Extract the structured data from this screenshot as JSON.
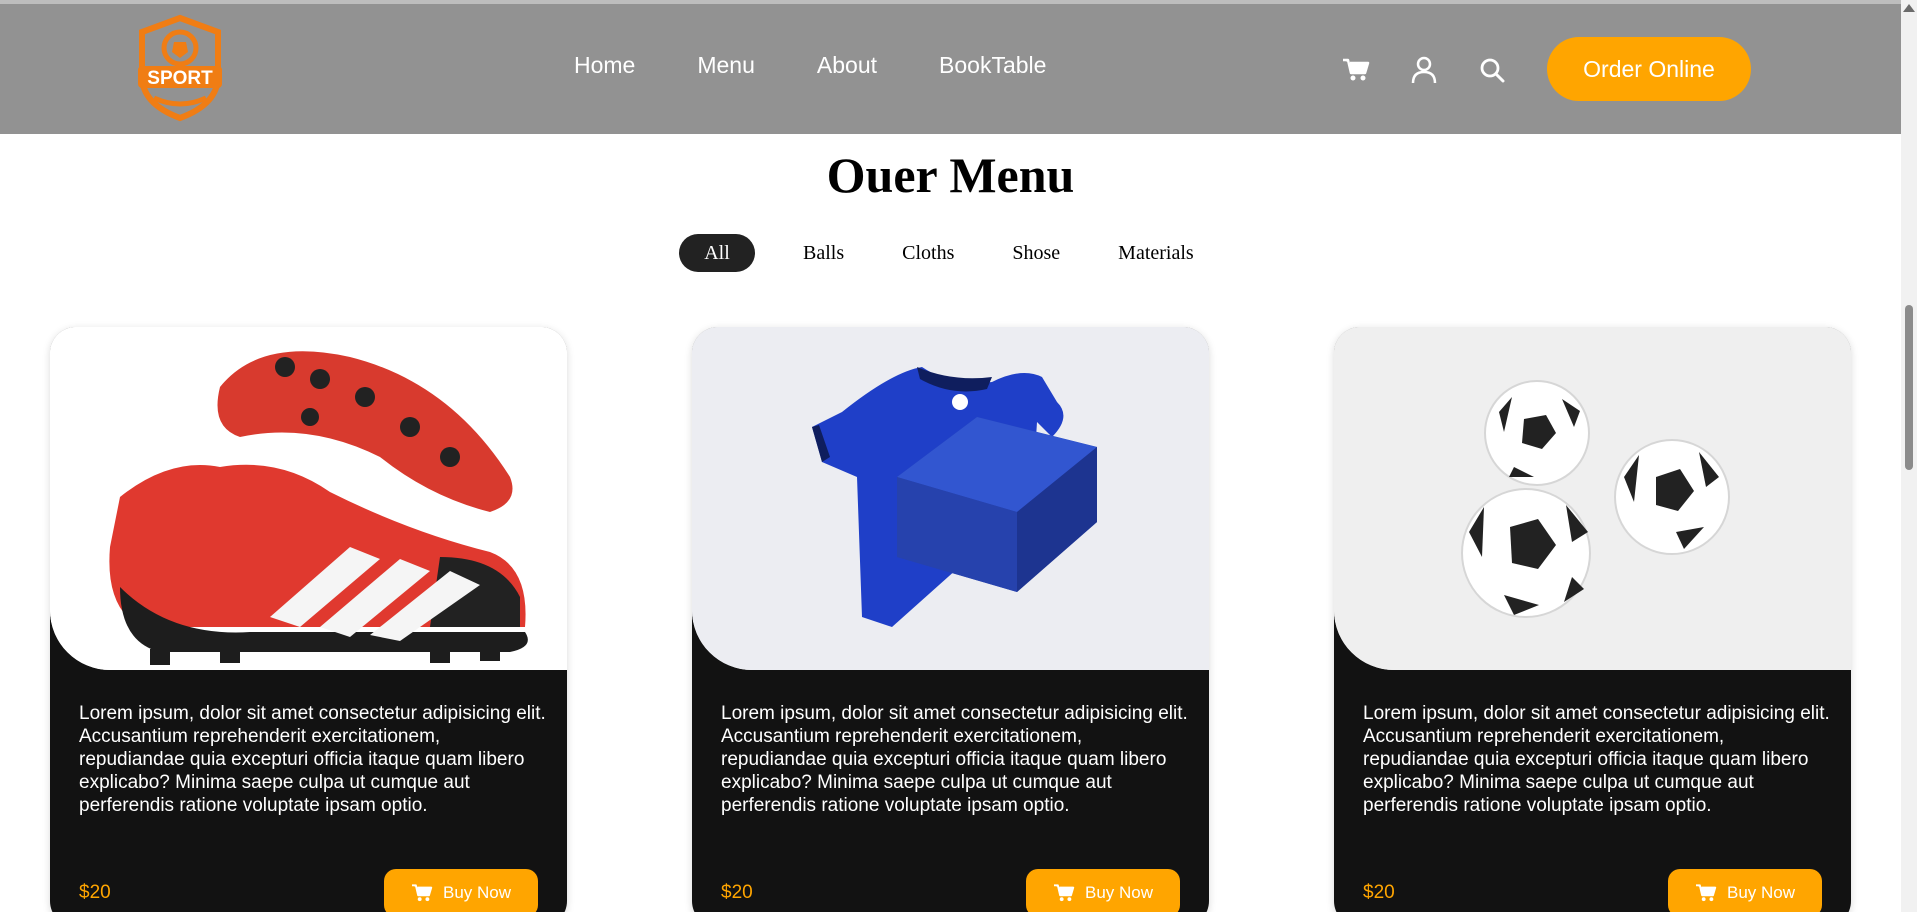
{
  "header": {
    "logo_text": "SPORT",
    "nav": [
      {
        "label": "Home"
      },
      {
        "label": "Menu"
      },
      {
        "label": "About"
      },
      {
        "label": "BookTable"
      }
    ],
    "icons": [
      "cart-icon",
      "user-icon",
      "search-icon"
    ],
    "order_button": "Order Online",
    "accent": "#ffa500",
    "background": "#929292"
  },
  "section": {
    "title": "Ouer Menu",
    "filters": [
      {
        "label": "All",
        "active": true
      },
      {
        "label": "Balls",
        "active": false
      },
      {
        "label": "Cloths",
        "active": false
      },
      {
        "label": "Shose",
        "active": false
      },
      {
        "label": "Materials",
        "active": false
      }
    ]
  },
  "cards": [
    {
      "image": "red-football-boot",
      "description": "Lorem ipsum, dolor sit amet consectetur adipisicing elit. Accusantium reprehenderit exercitationem, repudiandae quia excepturi officia itaque quam libero explicabo? Minima saepe culpa ut cumque aut perferendis ratione voluptate ipsam optio.",
      "price": "$20",
      "buy_label": "Buy Now"
    },
    {
      "image": "blue-jersey-with-box",
      "description": "Lorem ipsum, dolor sit amet consectetur adipisicing elit. Accusantium reprehenderit exercitationem, repudiandae quia excepturi officia itaque quam libero explicabo? Minima saepe culpa ut cumque aut perferendis ratione voluptate ipsam optio.",
      "price": "$20",
      "buy_label": "Buy Now"
    },
    {
      "image": "three-soccer-balls",
      "description": "Lorem ipsum, dolor sit amet consectetur adipisicing elit. Accusantium reprehenderit exercitationem, repudiandae quia excepturi officia itaque quam libero explicabo? Minima saepe culpa ut cumque aut perferendis ratione voluptate ipsam optio.",
      "price": "$20",
      "buy_label": "Buy Now"
    }
  ]
}
